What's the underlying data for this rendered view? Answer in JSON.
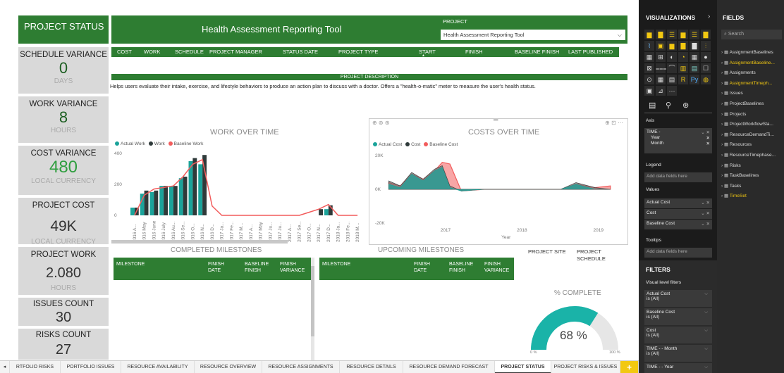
{
  "header": {
    "project_status": "PROJECT STATUS",
    "report_title": "Health Assessment Reporting Tool",
    "project_label": "PROJECT",
    "project_select_value": "Health Assessment Reporting Tool"
  },
  "columns": [
    "COST",
    "WORK",
    "SCHEDULE",
    "PROJECT MANAGER",
    "STATUS DATE",
    "PROJECT TYPE",
    "START",
    "FINISH",
    "BASELINE FINISH",
    "LAST PUBLISHED"
  ],
  "description": {
    "label": "PROJECT DESCRIPTION",
    "text": "Helps users evaluate their intake, exercise, and lifestyle behaviors to produce an action plan to discuss with a doctor. Offers a \"health-o-matic\" meter to measure the user's health status."
  },
  "kpis": {
    "schedule_variance": {
      "title": "SCHEDULE VARIANCE",
      "value": "0",
      "unit": "DAYS"
    },
    "work_variance": {
      "title": "WORK VARIANCE",
      "value": "8",
      "unit": "HOURS"
    },
    "cost_variance": {
      "title": "COST VARIANCE",
      "value": "480",
      "unit": "LOCAL CURRENCY"
    },
    "project_cost": {
      "title": "PROJECT COST",
      "value": "49K",
      "unit": "LOCAL CURRENCY"
    },
    "project_work": {
      "title": "PROJECT WORK",
      "value": "2.080",
      "unit": "HOURS"
    },
    "issues_count": {
      "title": "ISSUES COUNT",
      "value": "30"
    },
    "risks_count": {
      "title": "RISKS COUNT",
      "value": "27"
    }
  },
  "chart_data": [
    {
      "type": "bar",
      "title": "WORK OVER TIME",
      "legend": [
        "Actual Work",
        "Work",
        "Baseline Work"
      ],
      "colors": {
        "Actual Work": "#1aa39a",
        "Work": "#2f3a3a",
        "Baseline Work": "#f25c5c"
      },
      "ylim": [
        0,
        400
      ],
      "yticks": [
        "0",
        "200",
        "400"
      ],
      "categories": [
        "2016 A...",
        "2016 May",
        "2016 June",
        "2016 July",
        "2016 Au...",
        "2016 Se...",
        "2016 O...",
        "2016 N...",
        "2016 D...",
        "2017 Ja...",
        "2017 Fe...",
        "2017 M...",
        "2017 A...",
        "2017 May",
        "2017 Ju...",
        "2017 Ju...",
        "2017 A...",
        "2017 Se...",
        "2017 O...",
        "2017 N...",
        "2017 D...",
        "2018 Ja...",
        "2018 Fe...",
        "2018 M..."
      ],
      "series": [
        {
          "name": "Actual Work",
          "values": [
            50,
            140,
            150,
            190,
            190,
            240,
            350,
            330,
            0,
            0,
            0,
            0,
            0,
            0,
            0,
            0,
            0,
            0,
            0,
            0,
            40,
            0,
            0,
            0
          ]
        },
        {
          "name": "Work",
          "values": [
            50,
            160,
            160,
            190,
            190,
            250,
            370,
            390,
            0,
            0,
            0,
            0,
            0,
            0,
            0,
            0,
            0,
            0,
            0,
            40,
            65,
            0,
            0,
            0
          ]
        },
        {
          "name": "Baseline Work",
          "values": [
            0,
            130,
            170,
            180,
            190,
            250,
            330,
            360,
            60,
            0,
            0,
            0,
            0,
            0,
            0,
            0,
            0,
            0,
            20,
            40,
            70,
            0,
            0,
            0
          ]
        }
      ]
    },
    {
      "type": "area",
      "title": "COSTS OVER TIME",
      "legend": [
        "Actual Cost",
        "Cost",
        "Baseline Cost"
      ],
      "colors": {
        "Actual Cost": "#1aa39a",
        "Cost": "#2f3a3a",
        "Baseline Cost": "#f25c5c"
      },
      "ylim": [
        -20000,
        20000
      ],
      "yticks": [
        "20K",
        "0K",
        "-20K"
      ],
      "xticks": [
        "2017",
        "2018",
        "2019"
      ],
      "xlabel": "Year",
      "x": [
        2016.25,
        2016.4,
        2016.55,
        2016.7,
        2016.85,
        2016.95,
        2017.05,
        2017.2,
        2017.5,
        2017.8,
        2018.1,
        2018.3,
        2018.5,
        2018.7,
        2018.95,
        2019.15
      ],
      "series": [
        {
          "name": "Actual Cost",
          "values": [
            3000,
            1000,
            9000,
            5000,
            11000,
            13000,
            1000,
            -1000,
            0,
            0,
            0,
            0,
            0,
            3000,
            0,
            0
          ]
        },
        {
          "name": "Cost",
          "values": [
            5000,
            2000,
            10000,
            6000,
            12000,
            14000,
            2000,
            -1000,
            0,
            0,
            0,
            0,
            0,
            4000,
            1000,
            0
          ]
        },
        {
          "name": "Baseline Cost",
          "values": [
            4000,
            2000,
            9000,
            6000,
            11000,
            16000,
            15000,
            -1000,
            0,
            0,
            0,
            0,
            0,
            3000,
            1000,
            2000
          ]
        }
      ]
    },
    {
      "type": "gauge",
      "title": "% COMPLETE",
      "value": 68,
      "value_label": "68 %",
      "min_label": "0 %",
      "max_label": "100 %",
      "colors": {
        "fill": "#1ab3a8",
        "track": "#e6e6e6"
      }
    }
  ],
  "milestones": {
    "completed_title": "COMPLETED MILESTONES",
    "upcoming_title": "UPCOMING MILESTONES",
    "cols_milestone": "MILESTONE",
    "cols_finish": "FINISH DATE",
    "cols_baseline": "BASELINE FINISH",
    "cols_variance": "FINISH VARIANCE"
  },
  "links": {
    "project_site": "PROJECT SITE",
    "project_schedule": "PROJECT SCHEDULE"
  },
  "visualizations": {
    "title": "VISUALIZATIONS",
    "axis_label": "Axis",
    "axis_items": [
      "TIME -",
      "Year",
      "Month"
    ],
    "legend_label": "Legend",
    "legend_placeholder": "Add data fields here",
    "values_label": "Values",
    "values_items": [
      "Actual Cost",
      "Cost",
      "Baseline Cost"
    ],
    "tooltips_label": "Tooltips",
    "tooltips_placeholder": "Add data fields here",
    "filters_title": "FILTERS",
    "filters_sub": "Visual level filters",
    "filters": [
      {
        "name": "Actual Cost",
        "state": "is (All)"
      },
      {
        "name": "Baseline Cost",
        "state": "is (All)"
      },
      {
        "name": "Cost",
        "state": "is (All)"
      },
      {
        "name": "TIME - - Month",
        "state": "is (All)"
      },
      {
        "name": "TIME - - Year",
        "state": ""
      }
    ]
  },
  "fields": {
    "title": "FIELDS",
    "search_placeholder": "Search",
    "items": [
      "AssignmentBaselines",
      "AssignmentBaseline...",
      "Assignments",
      "AssignmentTimeph...",
      "Issues",
      "ProjectBaselines",
      "Projects",
      "ProjectWorkflowSta...",
      "ResourceDemandTi...",
      "Resources",
      "ResourceTimephase...",
      "Risks",
      "TaskBaselines",
      "Tasks",
      "TimeSet"
    ],
    "highlight_color": "#f2c811"
  },
  "tabs": [
    "RTFOLIO RISKS",
    "PORTFOLIO ISSUES",
    "RESOURCE AVAILABILITY",
    "RESOURCE OVERVIEW",
    "RESOURCE ASSIGNMENTS",
    "RESOURCE DETAILS",
    "RESOURCE DEMAND FORECAST",
    "PROJECT STATUS",
    "PROJECT RISKS & ISSUES"
  ],
  "active_tab": "PROJECT STATUS",
  "add_tab": "+"
}
